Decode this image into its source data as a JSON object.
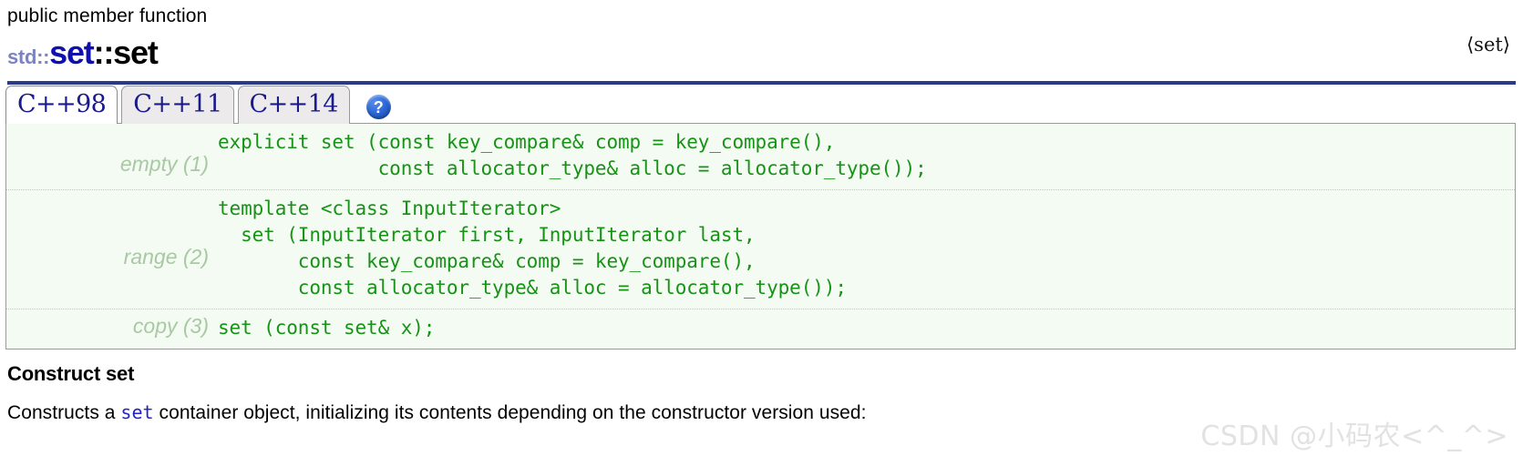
{
  "header": {
    "kind": "public member function",
    "namespace": "std::",
    "class_name": "set",
    "scope_separator": "::",
    "member_name": "set",
    "header_file": "⟨set⟩",
    "rule_color": "#2a3a8c"
  },
  "tabs": {
    "items": [
      {
        "label": "C++98",
        "active": true
      },
      {
        "label": "C++11",
        "active": false
      },
      {
        "label": "C++14",
        "active": false
      }
    ],
    "help_icon": "?",
    "help_icon_name": "help-icon",
    "active_color": "#1a1a8c"
  },
  "prototypes": {
    "code_color": "#169316",
    "label_color": "#a8c9a4",
    "rows": [
      {
        "label": "empty (1)",
        "code": "explicit set (const key_compare& comp = key_compare(),\n              const allocator_type& alloc = allocator_type());"
      },
      {
        "label": "range (2)",
        "code": "template <class InputIterator>\n  set (InputIterator first, InputIterator last,\n       const key_compare& comp = key_compare(),\n       const allocator_type& alloc = allocator_type());"
      },
      {
        "label": "copy (3)",
        "code": "set (const set& x);"
      }
    ]
  },
  "description": {
    "title": "Construct set",
    "para_before": "Constructs a ",
    "para_link": "set",
    "para_after": " container object, initializing its contents depending on the constructor version used:"
  },
  "watermark": {
    "text": "CSDN @小码农<^_^>",
    "color": "#e2e2e2"
  }
}
